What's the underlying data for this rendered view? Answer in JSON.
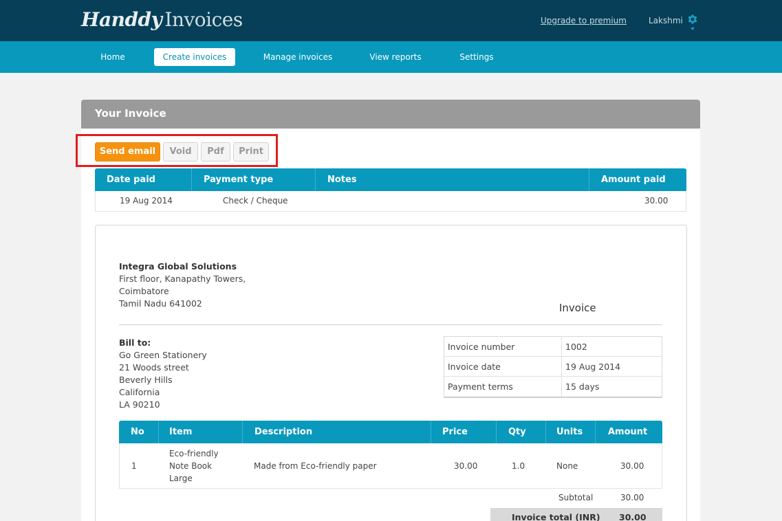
{
  "header": {
    "logo_script": "Handdy",
    "logo_plain": "Invoices",
    "upgrade_link": "Upgrade to premium",
    "user_name": "Lakshmi"
  },
  "nav": {
    "items": [
      {
        "label": "Home",
        "active": false
      },
      {
        "label": "Create invoices",
        "active": true
      },
      {
        "label": "Manage invoices",
        "active": false
      },
      {
        "label": "View reports",
        "active": false
      },
      {
        "label": "Settings",
        "active": false
      }
    ]
  },
  "panel": {
    "title": "Your Invoice"
  },
  "actions": {
    "send_email": "Send email",
    "void": "Void",
    "pdf": "Pdf",
    "print": "Print"
  },
  "payments": {
    "columns": [
      "Date paid",
      "Payment type",
      "Notes",
      "Amount paid"
    ],
    "rows": [
      {
        "date": "19 Aug 2014",
        "type": "Check / Cheque",
        "notes": "",
        "amount": "30.00"
      }
    ]
  },
  "invoice": {
    "title": "Invoice",
    "company": {
      "name": "Integra Global Solutions",
      "address1": "First floor, Kanapathy Towers,",
      "city": "Coimbatore",
      "region": "Tamil Nadu 641002"
    },
    "bill_to": {
      "label": "Bill to:",
      "name": "Go Green Stationery",
      "street": "21 Woods street",
      "city": "Beverly Hills",
      "state": "California",
      "zip": "LA 90210"
    },
    "meta": [
      {
        "key": "Invoice number",
        "value": "1002"
      },
      {
        "key": "Invoice date",
        "value": "19 Aug 2014"
      },
      {
        "key": "Payment terms",
        "value": "15 days"
      }
    ],
    "item_columns": [
      "No",
      "Item",
      "Description",
      "Price",
      "Qty",
      "Units",
      "Amount"
    ],
    "items": [
      {
        "no": "1",
        "item_line1": "Eco-friendly",
        "item_line2": "Note Book",
        "item_line3": "Large",
        "description": "Made from Eco-friendly paper",
        "price": "30.00",
        "qty": "1.0",
        "units": "None",
        "amount": "30.00"
      }
    ],
    "subtotal_label": "Subtotal",
    "subtotal_value": "30.00",
    "total_label": "Invoice total (INR)",
    "total_value": "30.00"
  },
  "colors": {
    "topbar": "#063f57",
    "navbar": "#0899bd",
    "accent_orange": "#f7920f",
    "highlight_red": "#e41b1b"
  }
}
